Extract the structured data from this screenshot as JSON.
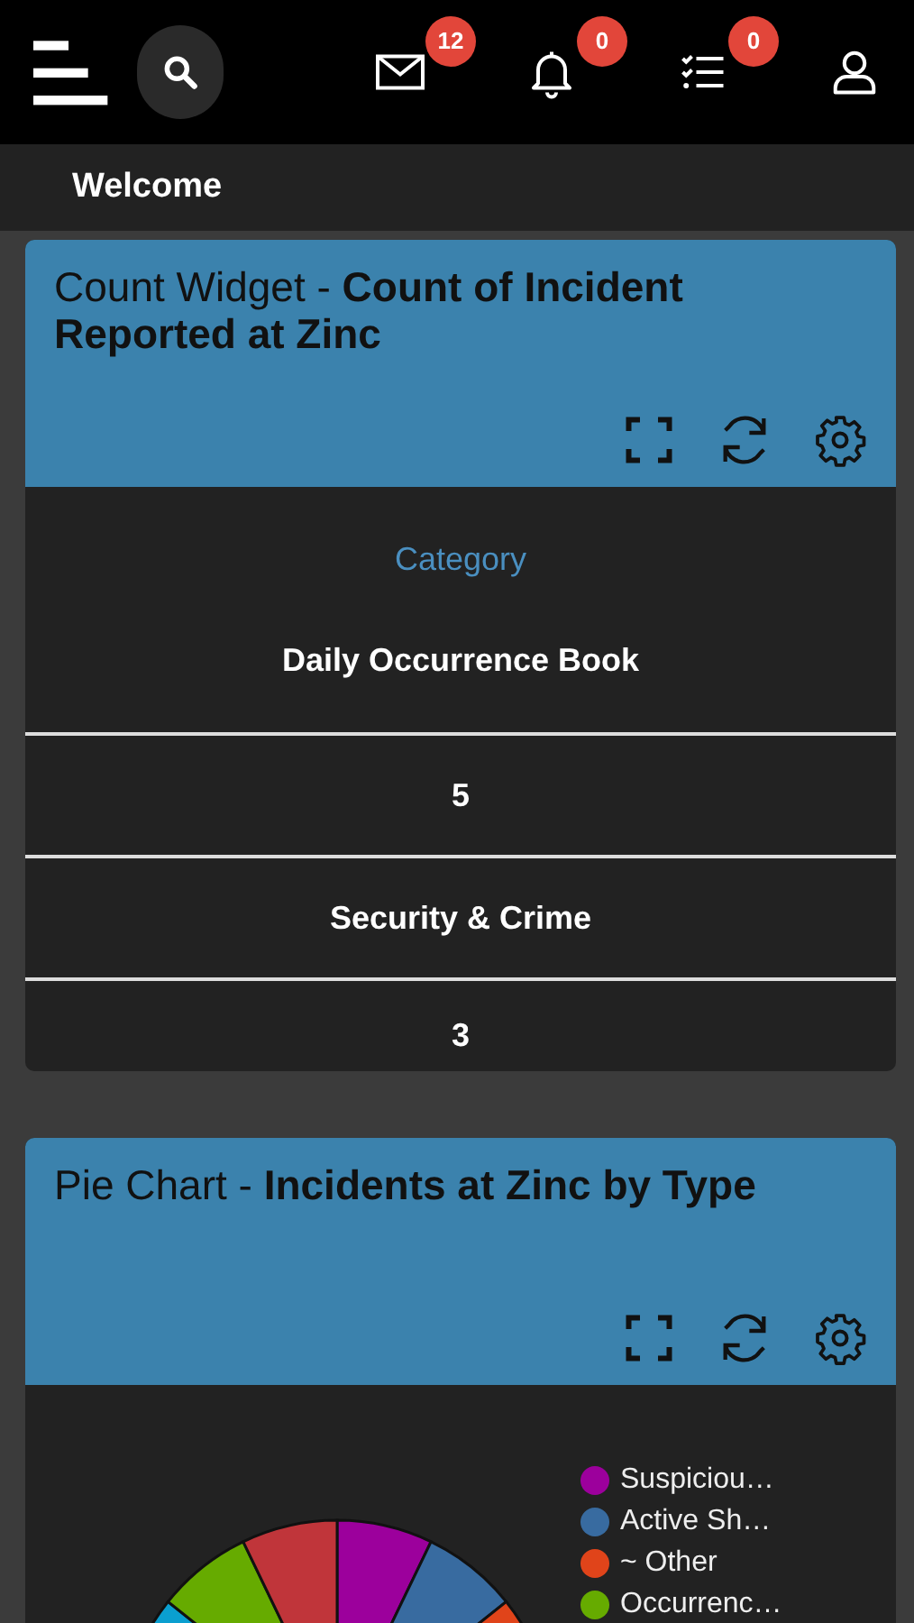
{
  "topbar": {
    "badges": [
      {
        "kind": "mail",
        "count": "12"
      },
      {
        "kind": "bell",
        "count": "0"
      },
      {
        "kind": "tasks",
        "count": "0"
      }
    ]
  },
  "page_title": "Welcome",
  "widgets": [
    {
      "kind": "count",
      "title_prefix": "Count Widget - ",
      "title": "Count of Incident Reported at Zinc",
      "column": "Category",
      "rows": [
        "Daily Occurrence Book",
        "5",
        "Security & Crime",
        "3"
      ]
    },
    {
      "kind": "pie",
      "title_prefix": "Pie Chart - ",
      "title": "Incidents at Zinc by Type",
      "legend": [
        {
          "label": "Suspiciou…",
          "color": "#9c009c"
        },
        {
          "label": "Active Sh…",
          "color": "#386ba0"
        },
        {
          "label": "~ Other",
          "color": "#e0441a"
        },
        {
          "label": "Occurrenc…",
          "color": "#66ab00"
        }
      ]
    }
  ]
}
